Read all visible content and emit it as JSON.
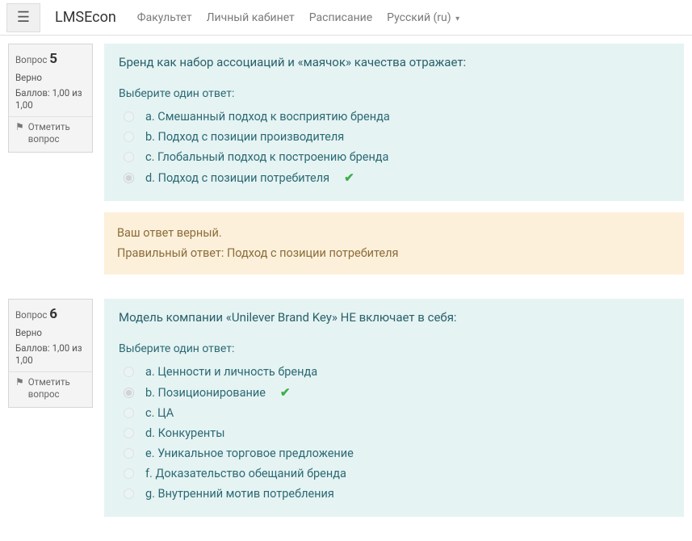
{
  "nav": {
    "brand": "LMSEcon",
    "links": [
      "Факультет",
      "Личный кабинет",
      "Расписание"
    ],
    "language": "Русский (ru)"
  },
  "common": {
    "question_label": "Вопрос",
    "flag_label": "Отметить вопрос",
    "choose_prompt": "Выберите один ответ:"
  },
  "q5": {
    "number": "5",
    "state": "Верно",
    "mark": "Баллов: 1,00 из 1,00",
    "text": "Бренд как набор ассоциаций и «маячок» качества отражает:",
    "answers": [
      {
        "letter": "a",
        "text": "Смешанный подход к восприятию бренда",
        "selected": false,
        "correct": false
      },
      {
        "letter": "b",
        "text": "Подход с позиции производителя",
        "selected": false,
        "correct": false
      },
      {
        "letter": "c",
        "text": "Глобальный подход к построению бренда",
        "selected": false,
        "correct": false
      },
      {
        "letter": "d",
        "text": "Подход с позиции потребителя",
        "selected": true,
        "correct": true
      }
    ],
    "feedback_line1": "Ваш ответ верный.",
    "feedback_line2": "Правильный ответ: Подход с позиции потребителя"
  },
  "q6": {
    "number": "6",
    "state": "Верно",
    "mark": "Баллов: 1,00 из 1,00",
    "text": "Модель компании «Unilever Brand Key» НЕ включает в себя:",
    "answers": [
      {
        "letter": "a",
        "text": "Ценности и личность бренда",
        "selected": false,
        "correct": false
      },
      {
        "letter": "b",
        "text": "Позиционирование",
        "selected": true,
        "correct": true
      },
      {
        "letter": "c",
        "text": "ЦА",
        "selected": false,
        "correct": false
      },
      {
        "letter": "d",
        "text": "Конкуренты",
        "selected": false,
        "correct": false
      },
      {
        "letter": "e",
        "text": "Уникальное торговое предложение",
        "selected": false,
        "correct": false
      },
      {
        "letter": "f",
        "text": "Доказательство обещаний бренда",
        "selected": false,
        "correct": false
      },
      {
        "letter": "g",
        "text": "Внутренний мотив потребления",
        "selected": false,
        "correct": false
      }
    ]
  }
}
